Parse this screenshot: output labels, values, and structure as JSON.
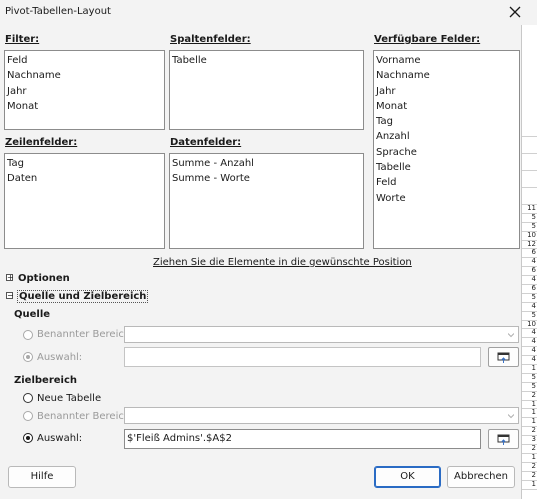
{
  "window": {
    "title": "Pivot-Tabellen-Layout"
  },
  "filter": {
    "label": "Filter:",
    "items": [
      "Feld",
      "Nachname",
      "Jahr",
      "Monat"
    ]
  },
  "column_fields": {
    "label": "Spaltenfelder:",
    "items": [
      "Tabelle"
    ]
  },
  "available_fields": {
    "label": "Verfügbare Felder:",
    "items": [
      "Vorname",
      "Nachname",
      "Jahr",
      "Monat",
      "Tag",
      "Anzahl",
      "Sprache",
      "Tabelle",
      "Feld",
      "Worte"
    ]
  },
  "row_fields": {
    "label": "Zeilenfelder:",
    "items": [
      "Tag",
      "Daten"
    ]
  },
  "data_fields": {
    "label": "Datenfelder:",
    "items": [
      "Summe - Anzahl",
      "Summe - Worte"
    ]
  },
  "hint": "Ziehen Sie die Elemente in die gewünschte Position",
  "options": {
    "label": "Optionen",
    "expand_symbol": "+"
  },
  "source_dest": {
    "label": "Quelle und Zielbereich",
    "expand_symbol": "−"
  },
  "source": {
    "heading": "Quelle",
    "named_range_label": "Benannter Bereich:",
    "named_range_value": "",
    "selection_label": "Auswahl:",
    "selection_value": ""
  },
  "destination": {
    "heading": "Zielbereich",
    "new_table_label": "Neue Tabelle",
    "named_range_label": "Benannter Bereich:",
    "named_range_value": "",
    "selection_label": "Auswahl:",
    "selection_value": "$'Fleiß Admins'.$A$2"
  },
  "buttons": {
    "help": "Hilfe",
    "ok": "OK",
    "cancel": "Abbrechen"
  },
  "background_sheet": {
    "row_numbers": [
      "11",
      "5",
      "5",
      "10",
      "12",
      "6",
      "4",
      "6",
      "4",
      "6",
      "5",
      "4",
      "5",
      "10",
      "4",
      "4",
      "4",
      "4",
      "1",
      "5",
      "5",
      "2",
      "1",
      "1",
      "1",
      "2",
      "3",
      "2",
      "1",
      "2",
      "2",
      "1"
    ]
  },
  "colors": {
    "accent": "#2a6bc4",
    "window_bg": "#f3f3f3",
    "list_bg": "#ffffff"
  }
}
